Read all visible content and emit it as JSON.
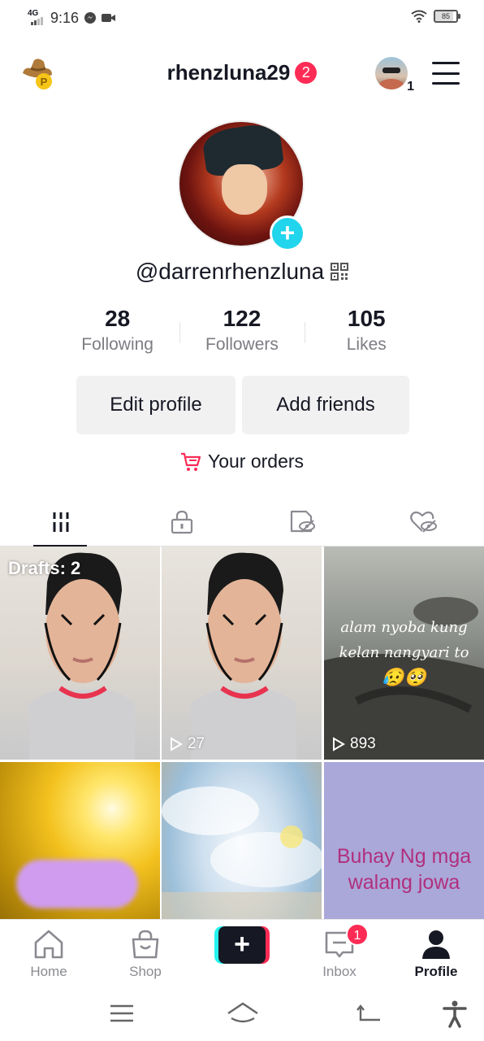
{
  "status_bar": {
    "network": "4G",
    "time": "9:16",
    "battery": "85"
  },
  "header": {
    "username": "rhenzluna29",
    "username_badge": "2",
    "account_count": "1"
  },
  "profile": {
    "handle": "@darrenrhenzluna",
    "stats": [
      {
        "value": "28",
        "label": "Following"
      },
      {
        "value": "122",
        "label": "Followers"
      },
      {
        "value": "105",
        "label": "Likes"
      }
    ],
    "edit_profile_label": "Edit profile",
    "add_friends_label": "Add friends",
    "orders_label": "Your orders"
  },
  "tabs": [
    "videos-grid-icon",
    "private-lock-icon",
    "hidden-reposts-icon",
    "liked-hidden-icon"
  ],
  "videos": [
    {
      "overlay": "Drafts: 2",
      "views": ""
    },
    {
      "overlay": "",
      "views": "27"
    },
    {
      "overlay": "",
      "views": "893",
      "caption_lines": [
        "alam nyoba kung",
        "kelan nangyari to"
      ],
      "emojis": "😥🥺"
    },
    {
      "overlay": "",
      "views": ""
    },
    {
      "overlay": "",
      "views": ""
    },
    {
      "overlay": "",
      "views": "",
      "caption_lines": [
        "Buhay Ng mga",
        "walang jowa"
      ]
    }
  ],
  "bottom_nav": {
    "home": "Home",
    "shop": "Shop",
    "create": "+",
    "inbox": "Inbox",
    "inbox_badge": "1",
    "profile": "Profile"
  },
  "colors": {
    "accent_red": "#fe2c55",
    "accent_cyan": "#20d5ec",
    "text_primary": "#161823",
    "text_secondary": "#7c7d83"
  }
}
